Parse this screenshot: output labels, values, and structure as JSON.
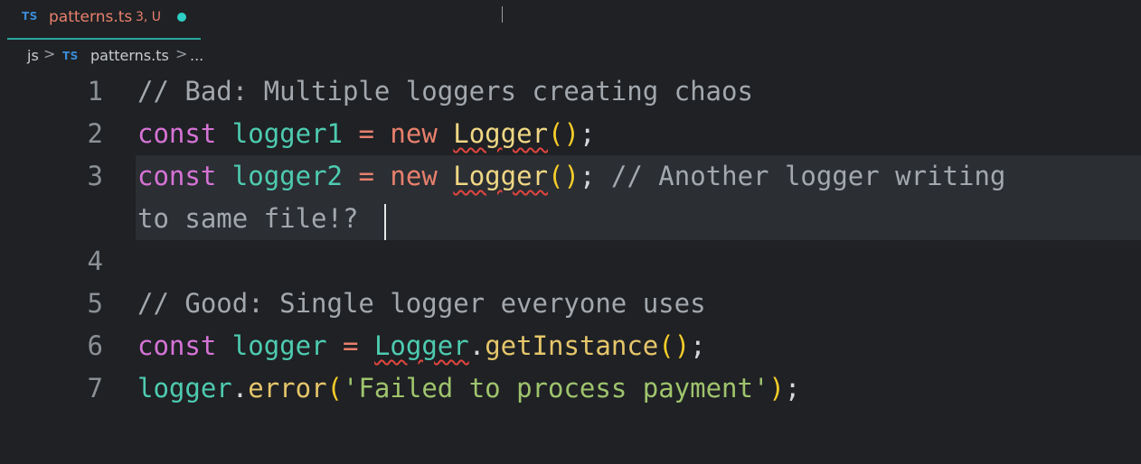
{
  "tab": {
    "lang_badge": "TS",
    "file_name": "patterns.ts",
    "status": "3, U"
  },
  "breadcrumb": {
    "folder": "js",
    "sep": ">",
    "lang_badge": "TS",
    "file": "patterns.ts",
    "more": "..."
  },
  "editor": {
    "line_numbers": [
      "1",
      "2",
      "3",
      "4",
      "5",
      "6",
      "7"
    ],
    "tokens": {
      "l1_comment": "// Bad: Multiple loggers creating chaos",
      "l2_kw": "const",
      "l2_var": "logger1",
      "l2_eq": "=",
      "l2_new": "new",
      "l2_class": "Logger",
      "l2_paren": "()",
      "l2_semi": ";",
      "l3_kw": "const",
      "l3_var": "logger2",
      "l3_eq": "=",
      "l3_new": "new",
      "l3_class": "Logger",
      "l3_paren": "()",
      "l3_semi": ";",
      "l3_comment_a": "// Another logger writing",
      "l3_comment_b": "to same file!?",
      "l5_comment": "// Good: Single logger everyone uses",
      "l6_kw": "const",
      "l6_var": "logger",
      "l6_eq": "=",
      "l6_class": "Logger",
      "l6_dot": ".",
      "l6_fn": "getInstance",
      "l6_paren": "()",
      "l6_semi": ";",
      "l7_var": "logger",
      "l7_dot": ".",
      "l7_fn": "error",
      "l7_open": "(",
      "l7_str": "'Failed to process payment'",
      "l7_close": ")",
      "l7_semi": ";"
    }
  }
}
